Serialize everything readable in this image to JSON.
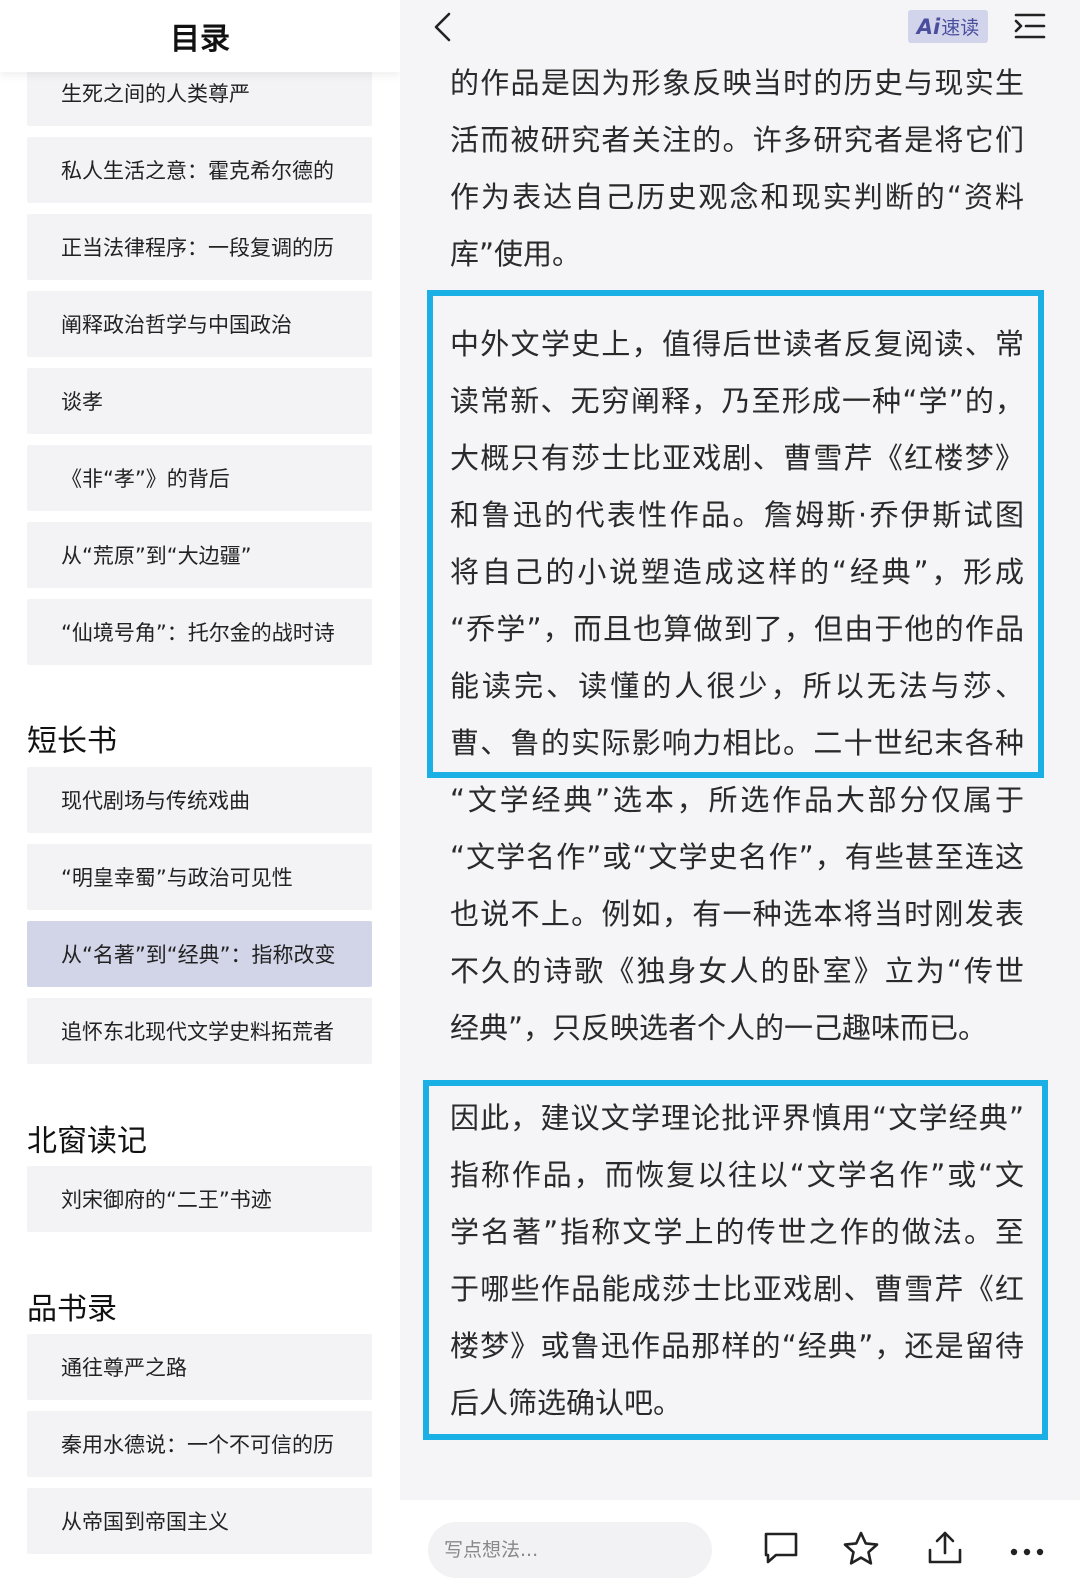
{
  "toc": {
    "title": "目录",
    "items": [
      "生死之间的人类尊严",
      "私人生活之意：霍克希尔德的",
      "正当法律程序：一段复调的历",
      "阐释政治哲学与中国政治",
      "谈孝",
      "《非“孝”》的背后",
      "从“荒原”到“大边疆”",
      "“仙境号角”：托尔金的战时诗"
    ],
    "sections": [
      {
        "title": "短长书",
        "items": [
          "现代剧场与传统戏曲",
          "“明皇幸蜀”与政治可见性",
          "从“名著”到“经典”：指称改变",
          "追怀东北现代文学史料拓荒者"
        ],
        "active_index": 2
      },
      {
        "title": "北窗读记",
        "items": [
          "刘宋御府的“二王”书迹"
        ]
      },
      {
        "title": "品书录",
        "items": [
          "通往尊严之路",
          "秦用水德说：一个不可信的历",
          "从帝国到帝国主义"
        ]
      }
    ]
  },
  "reader": {
    "ai_badge": {
      "mark": "Ai",
      "label": "速读"
    },
    "paragraphs": [
      {
        "lines": [
          "的作品是因为形象反映当时的历史与现实生",
          "活而被研究者关注的。许多研究者是将它们",
          "作为表达自己历史观念和现实判断的“资料",
          "库”使用。"
        ]
      },
      {
        "lines": [
          "中外文学史上，值得后世读者反复阅读、常",
          "读常新、无穷阐释，乃至形成一种“学”的，",
          "大概只有莎士比亚戏剧、曹雪芹《红楼梦》",
          "和鲁迅的代表性作品。詹姆斯·乔伊斯试图",
          "将自己的小说塑造成这样的“经典”，形成",
          "“乔学”，而且也算做到了，但由于他的作品",
          "能读完、读懂的人很少，所以无法与莎、",
          "曹、鲁的实际影响力相比。二十世纪末各种",
          "“文学经典”选本，所选作品大部分仅属于",
          "“文学名作”或“文学史名作”，有些甚至连这",
          "也说不上。例如，有一种选本将当时刚发表",
          "不久的诗歌《独身女人的卧室》立为“传世",
          "经典”，只反映选者个人的一己趣味而已。"
        ]
      },
      {
        "lines": [
          "因此，建议文学理论批评界慎用“文学经典”",
          "指称作品，而恢复以往以“文学名作”或“文",
          "学名著”指称文学上的传世之作的做法。至",
          "于哪些作品能成莎士比亚戏剧、曹雪芹《红",
          "楼梦》或鲁迅作品那样的“经典”，还是留待",
          "后人筛选确认吧。"
        ]
      }
    ],
    "highlight_color": "#1ab0e6"
  },
  "bottom_bar": {
    "comment_placeholder": "写点想法...",
    "icons": [
      "comment-icon",
      "star-icon",
      "share-icon",
      "more-icon"
    ]
  }
}
